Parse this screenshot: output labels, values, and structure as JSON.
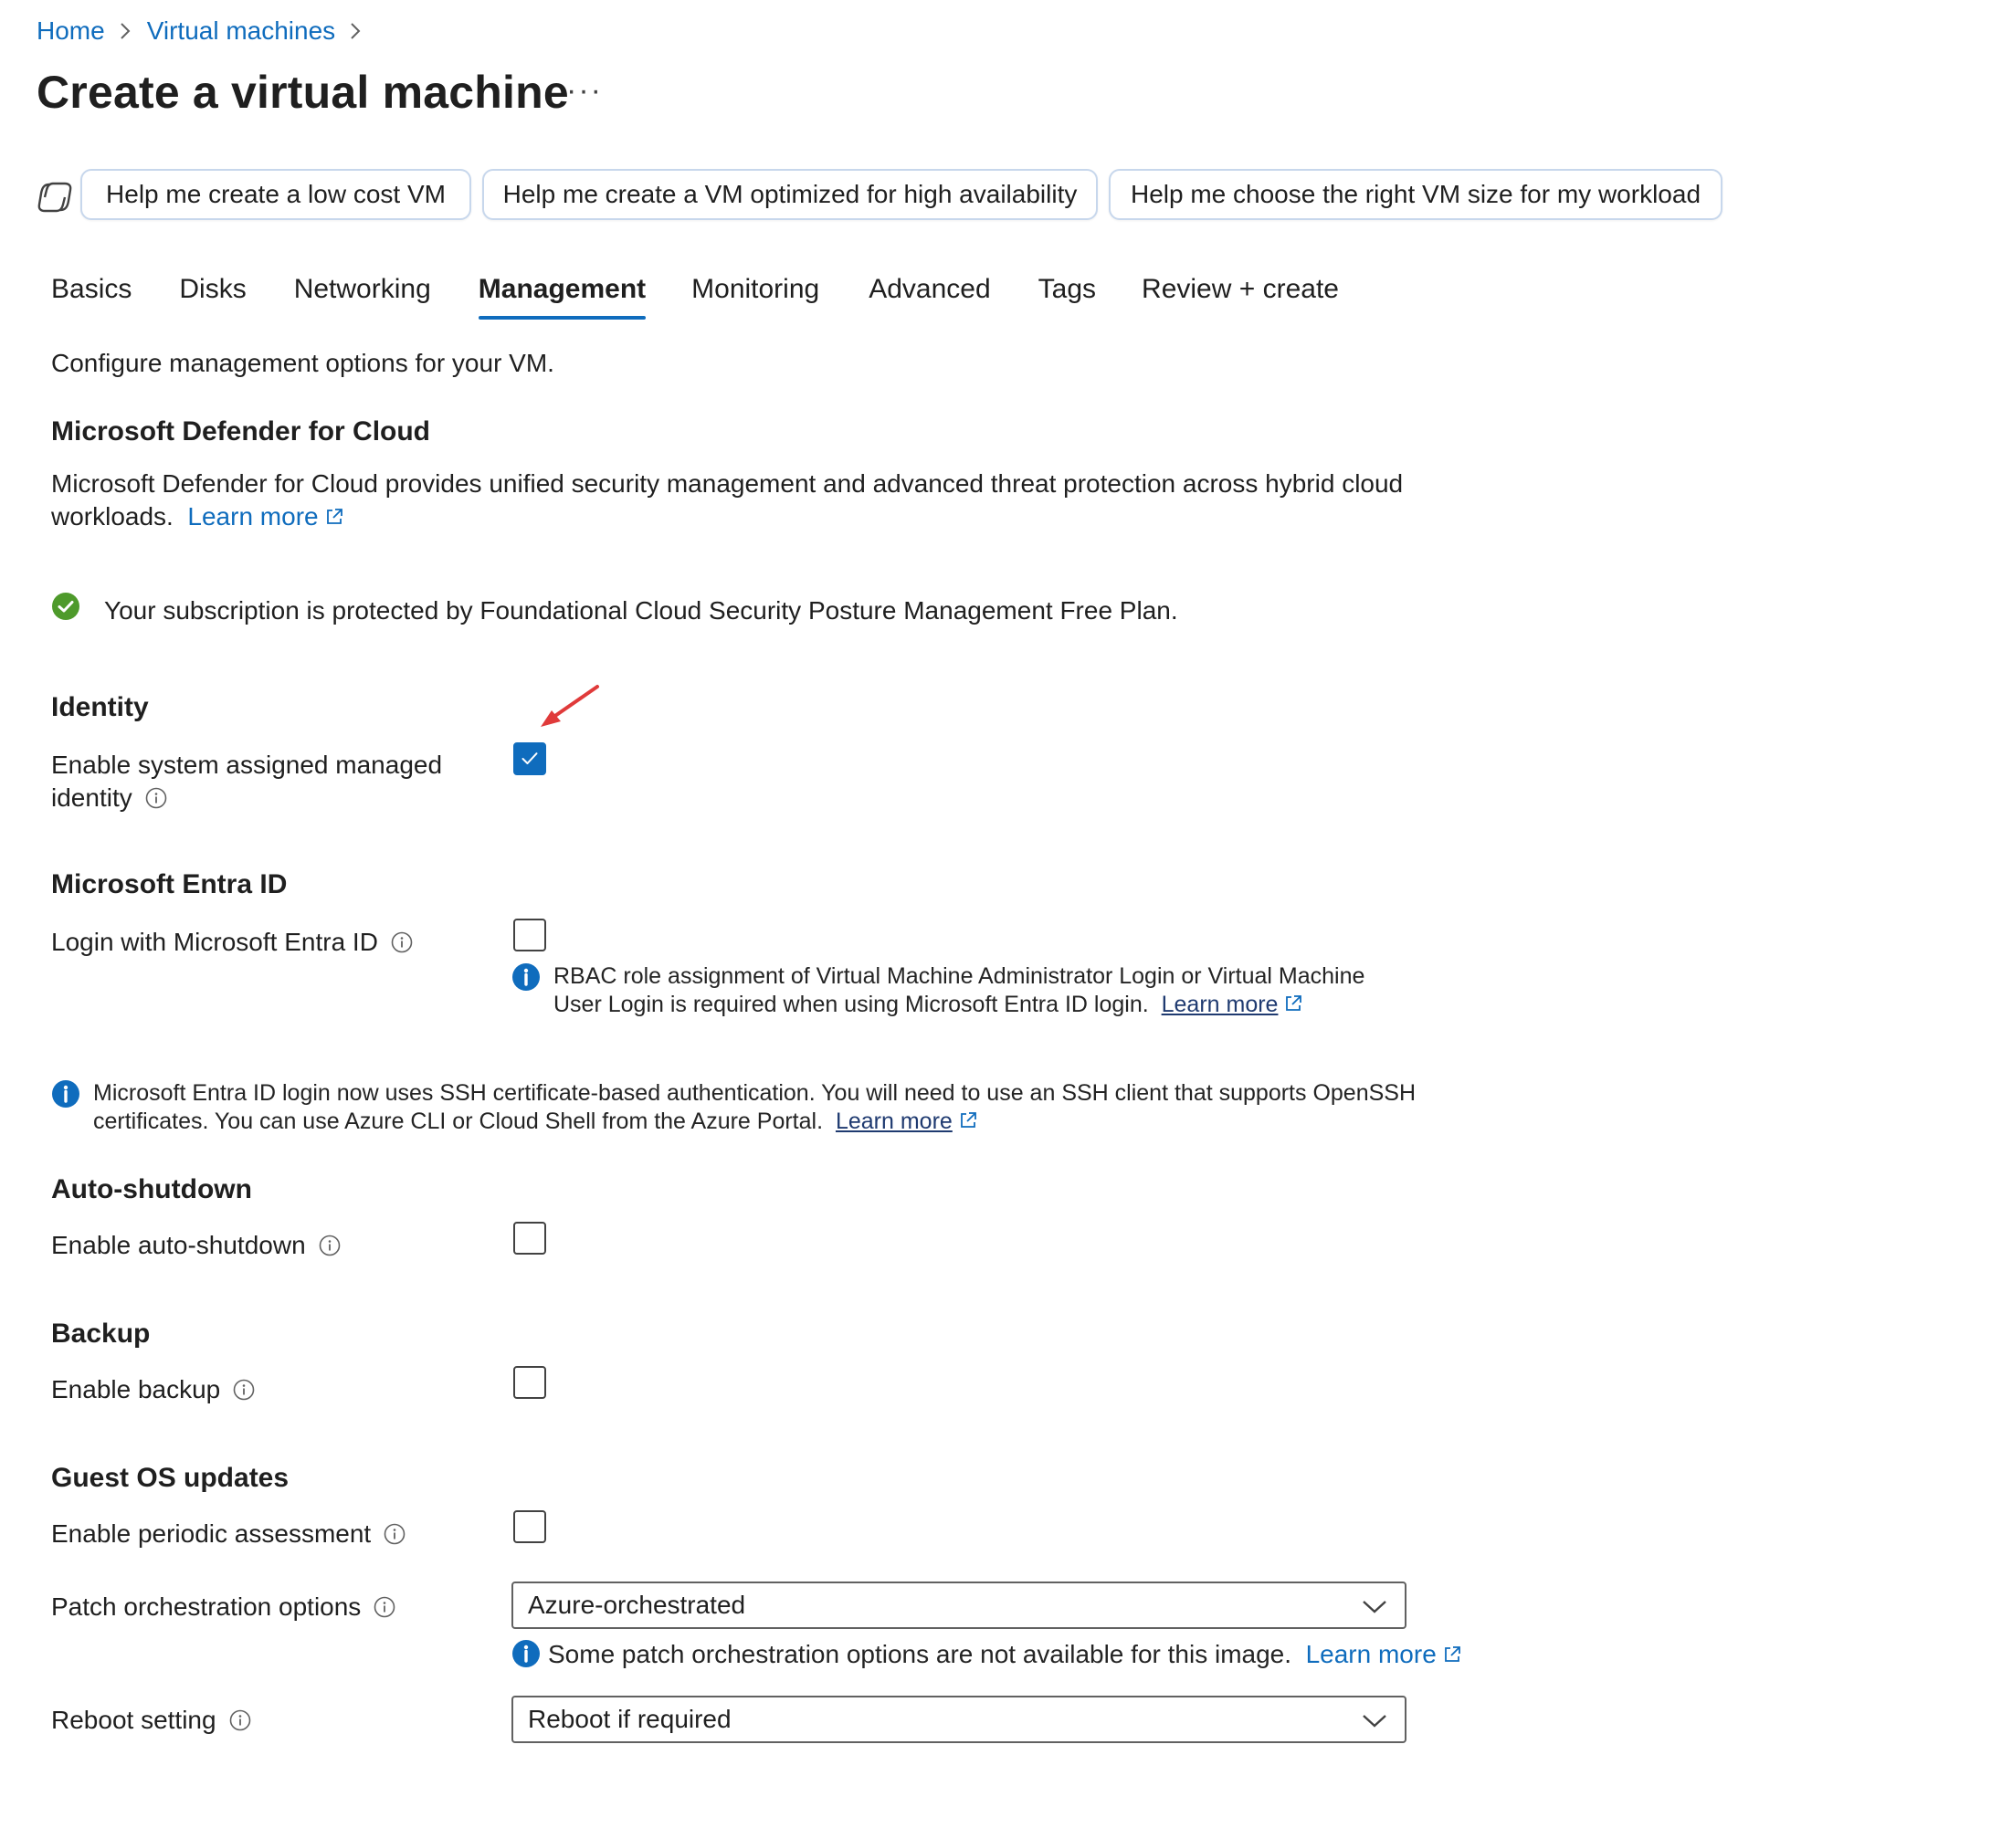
{
  "breadcrumb": {
    "home": "Home",
    "vms": "Virtual machines"
  },
  "page": {
    "title": "Create a virtual machine",
    "more": "···"
  },
  "copilot": {
    "chip1": "Help me create a low cost VM",
    "chip2": "Help me create a VM optimized for high availability",
    "chip3": "Help me choose the right VM size for my workload"
  },
  "tabs": [
    "Basics",
    "Disks",
    "Networking",
    "Management",
    "Monitoring",
    "Advanced",
    "Tags",
    "Review + create"
  ],
  "active_tab": "Management",
  "intro": "Configure management options for your VM.",
  "defender": {
    "heading": "Microsoft Defender for Cloud",
    "desc_line1": "Microsoft Defender for Cloud provides unified security management and advanced threat protection across hybrid cloud",
    "desc_line2": "workloads.",
    "learn_more": "Learn more",
    "status": "Your subscription is protected by Foundational Cloud Security Posture Management Free Plan."
  },
  "identity": {
    "heading": "Identity",
    "label_line1": "Enable system assigned managed",
    "label_line2": "identity",
    "checked": true
  },
  "entra": {
    "heading": "Microsoft Entra ID",
    "label": "Login with Microsoft Entra ID",
    "checked": false,
    "note_line1": "RBAC role assignment of Virtual Machine Administrator Login or Virtual Machine",
    "note_line2": "User Login is required when using Microsoft Entra ID login.",
    "note_learn_more": "Learn more",
    "banner_line1": "Microsoft Entra ID login now uses SSH certificate-based authentication. You will need to use an SSH client that supports OpenSSH",
    "banner_line2": "certificates. You can use Azure CLI or Cloud Shell from the Azure Portal.",
    "banner_learn_more": "Learn more"
  },
  "autoshutdown": {
    "heading": "Auto-shutdown",
    "label": "Enable auto-shutdown",
    "checked": false
  },
  "backup": {
    "heading": "Backup",
    "label": "Enable backup",
    "checked": false
  },
  "guest_os": {
    "heading": "Guest OS updates",
    "periodic_label": "Enable periodic assessment",
    "periodic_checked": false,
    "patch_label": "Patch orchestration options",
    "patch_value": "Azure-orchestrated",
    "patch_note": "Some patch orchestration options are not available for this image.",
    "patch_learn_more": "Learn more",
    "reboot_label": "Reboot setting",
    "reboot_value": "Reboot if required"
  },
  "colors": {
    "accent": "#0f6cbd",
    "success": "#4e9a2b",
    "annotation_arrow": "#e03a3a"
  }
}
